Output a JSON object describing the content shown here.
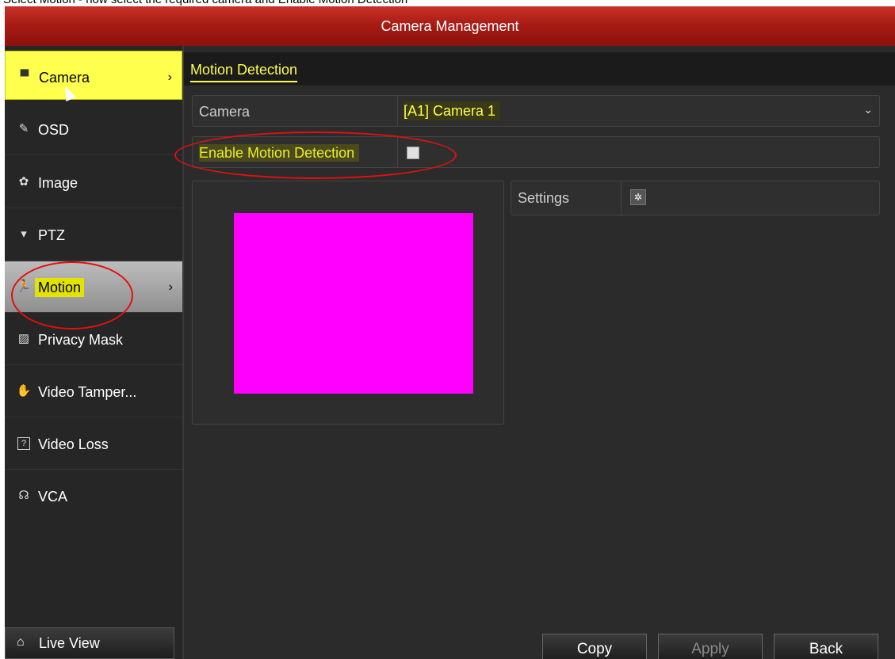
{
  "caption": "Select Motion - now select the required camera and Enable Motion Detection",
  "window": {
    "title": "Camera Management"
  },
  "sidebar": {
    "items": [
      {
        "label": "Camera",
        "icon": "camera-icon",
        "glyph": "▀",
        "arrow": "›"
      },
      {
        "label": "OSD",
        "icon": "pencil-icon",
        "glyph": "✎"
      },
      {
        "label": "Image",
        "icon": "image-icon",
        "glyph": "✿"
      },
      {
        "label": "PTZ",
        "icon": "ptz-icon",
        "glyph": "▾"
      },
      {
        "label": "Motion",
        "icon": "motion-icon",
        "glyph": "🏃",
        "arrow": "›"
      },
      {
        "label": "Privacy Mask",
        "icon": "privacy-mask-icon",
        "glyph": "▨"
      },
      {
        "label": "Video Tamper...",
        "icon": "hand-icon",
        "glyph": "✋"
      },
      {
        "label": "Video Loss",
        "icon": "question-icon",
        "glyph": "?"
      },
      {
        "label": "VCA",
        "icon": "vca-icon",
        "glyph": "☊"
      }
    ],
    "live_view": {
      "label": "Live View",
      "icon": "home-icon",
      "glyph": "⌂"
    }
  },
  "main": {
    "tab": "Motion Detection",
    "camera_label": "Camera",
    "camera_value": "[A1] Camera 1",
    "enable_label": "Enable Motion Detection",
    "enable_checked": false,
    "settings_label": "Settings",
    "settings_glyph": "✲"
  },
  "buttons": {
    "copy": "Copy",
    "apply": "Apply",
    "back": "Back"
  },
  "colors": {
    "accent": "#ffff4d",
    "title_bar": "#a81c14",
    "preview": "#ff00ff",
    "annotation": "#e01010"
  }
}
